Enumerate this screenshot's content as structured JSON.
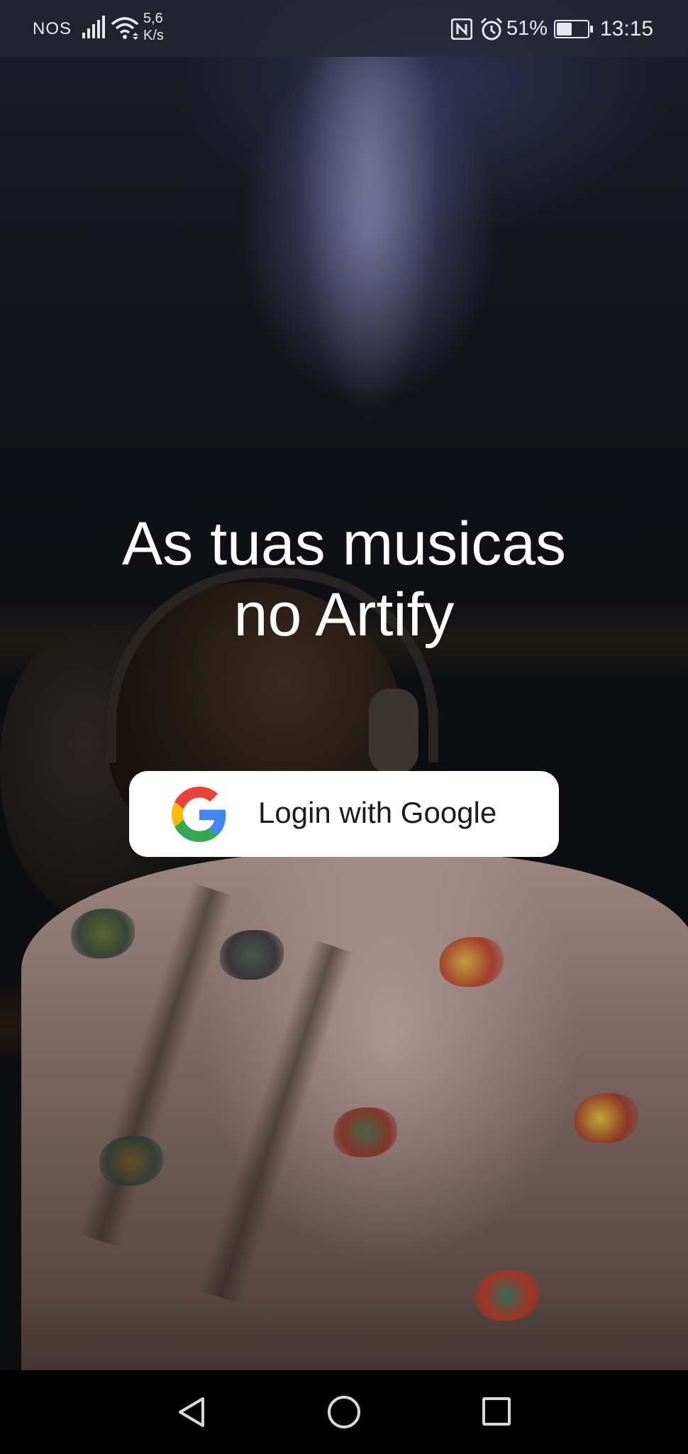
{
  "status_bar": {
    "carrier": "NOS",
    "network_speed_value": "5,6",
    "network_speed_unit": "K/s",
    "battery_percent": "51%",
    "battery_level": 0.51,
    "time": "13:15",
    "icons": [
      "signal-icon",
      "wifi-icon",
      "nfc-icon",
      "alarm-icon",
      "battery-icon"
    ]
  },
  "main": {
    "headline_line1": "As tuas musicas",
    "headline_line2": "no Artify",
    "login_button": {
      "label": "Login with Google",
      "icon": "google-icon"
    }
  },
  "nav_bar": {
    "icons": [
      "back-icon",
      "home-icon",
      "recent-apps-icon"
    ]
  },
  "colors": {
    "headline": "#ffffff",
    "button_bg": "#ffffff",
    "button_text": "#1c1c1c",
    "google_blue": "#4285F4",
    "google_red": "#EA4335",
    "google_yellow": "#FBBC05",
    "google_green": "#34A853"
  }
}
